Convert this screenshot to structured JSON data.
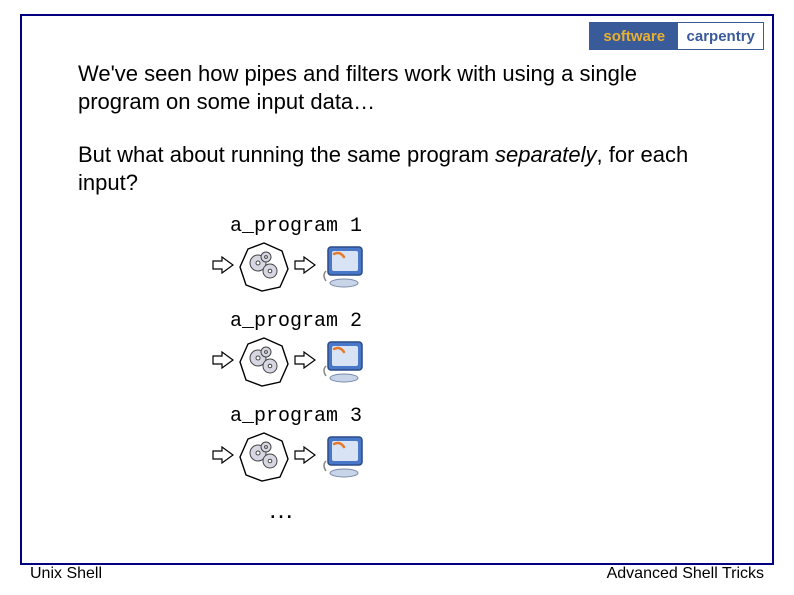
{
  "logo": {
    "left": "software",
    "right": "carpentry"
  },
  "para1": "We've seen how pipes and filters work with using a single program on some input data…",
  "para2_a": "But what about running the same program ",
  "para2_b": "separately",
  "para2_c": ", for each input?",
  "programs": {
    "p1": "a_program 1",
    "p2": "a_program 2",
    "p3": "a_program 3"
  },
  "ellipsis": "…",
  "footer": {
    "left": "Unix Shell",
    "right": "Advanced Shell Tricks"
  }
}
